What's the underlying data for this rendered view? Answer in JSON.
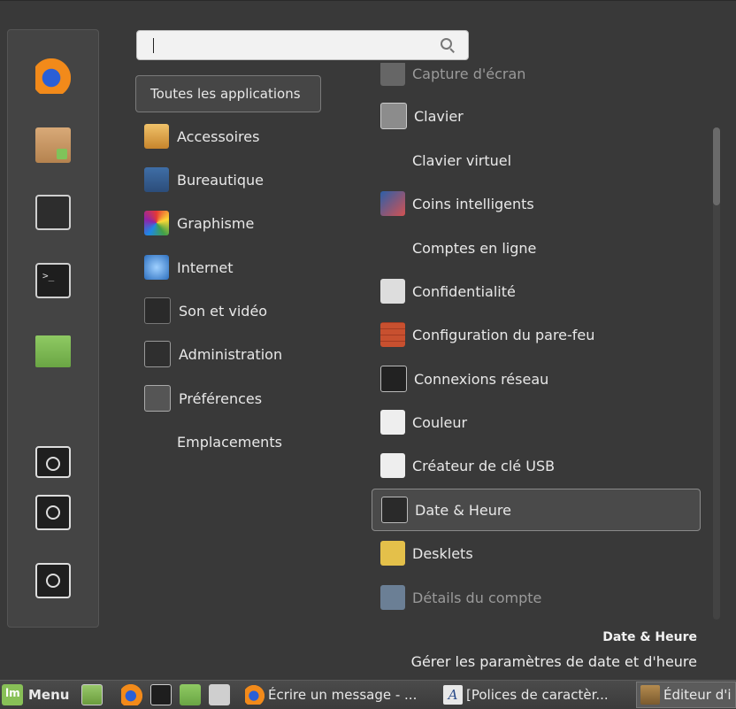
{
  "search": {
    "value": "",
    "placeholder": ""
  },
  "categories": [
    {
      "label": "Toutes les applications",
      "icon": "all-apps-icon"
    },
    {
      "label": "Accessoires",
      "icon": "accessories-icon"
    },
    {
      "label": "Bureautique",
      "icon": "office-icon"
    },
    {
      "label": "Graphisme",
      "icon": "graphics-icon"
    },
    {
      "label": "Internet",
      "icon": "internet-icon"
    },
    {
      "label": "Son et vidéo",
      "icon": "sound-video-icon"
    },
    {
      "label": "Administration",
      "icon": "administration-icon"
    },
    {
      "label": "Préférences",
      "icon": "preferences-icon"
    },
    {
      "label": "Emplacements",
      "icon": "places-icon"
    }
  ],
  "apps": [
    {
      "label": "Capture d'écran",
      "icon": "screenshot-icon"
    },
    {
      "label": "Clavier",
      "icon": "keyboard-icon"
    },
    {
      "label": "Clavier virtuel",
      "icon": "virtual-keyboard-icon"
    },
    {
      "label": "Coins intelligents",
      "icon": "hot-corners-icon"
    },
    {
      "label": "Comptes en ligne",
      "icon": "online-accounts-icon"
    },
    {
      "label": "Confidentialité",
      "icon": "privacy-icon"
    },
    {
      "label": "Configuration du pare-feu",
      "icon": "firewall-icon"
    },
    {
      "label": "Connexions réseau",
      "icon": "network-icon"
    },
    {
      "label": "Couleur",
      "icon": "color-icon"
    },
    {
      "label": "Créateur de clé USB",
      "icon": "usb-creator-icon"
    },
    {
      "label": "Date & Heure",
      "icon": "date-time-icon",
      "selected": true
    },
    {
      "label": "Desklets",
      "icon": "desklets-icon"
    },
    {
      "label": "Détails du compte",
      "icon": "account-details-icon"
    }
  ],
  "description": {
    "title": "Date & Heure",
    "text": "Gérer les paramètres de date et d'heure"
  },
  "favorites": [
    "firefox-icon",
    "software-manager-icon",
    "system-settings-icon",
    "terminal-icon",
    "files-icon",
    "lock-screen-icon",
    "logout-icon",
    "power-icon"
  ],
  "taskbar": {
    "menu_label": "Menu",
    "tasks": [
      {
        "label": "Écrire un message - ..."
      },
      {
        "label": "[Polices de caractèr..."
      },
      {
        "label": "Éditeur d'i"
      }
    ]
  }
}
